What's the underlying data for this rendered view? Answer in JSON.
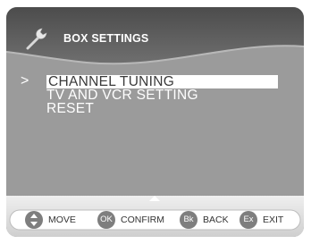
{
  "header": {
    "title": "BOX SETTINGS",
    "icon": "wrench-icon"
  },
  "menu": {
    "cursor": ">",
    "items": [
      {
        "label": "CHANNEL TUNING",
        "selected": true
      },
      {
        "label": "TV AND VCR SETTING",
        "selected": false
      },
      {
        "label": "RESET",
        "selected": false
      }
    ]
  },
  "footer": {
    "hints": [
      {
        "key": "",
        "icon": "arrows-updown-icon",
        "label": "MOVE"
      },
      {
        "key": "OK",
        "label": "CONFIRM"
      },
      {
        "key": "Bk",
        "label": "BACK"
      },
      {
        "key": "Ex",
        "label": "EXIT"
      }
    ]
  },
  "colors": {
    "screen": "#999999",
    "header_band": "#5f5f5f",
    "footer_bg": "#dcdcdc",
    "selection": "#ffffff",
    "key_button": "#7e7e7e"
  }
}
